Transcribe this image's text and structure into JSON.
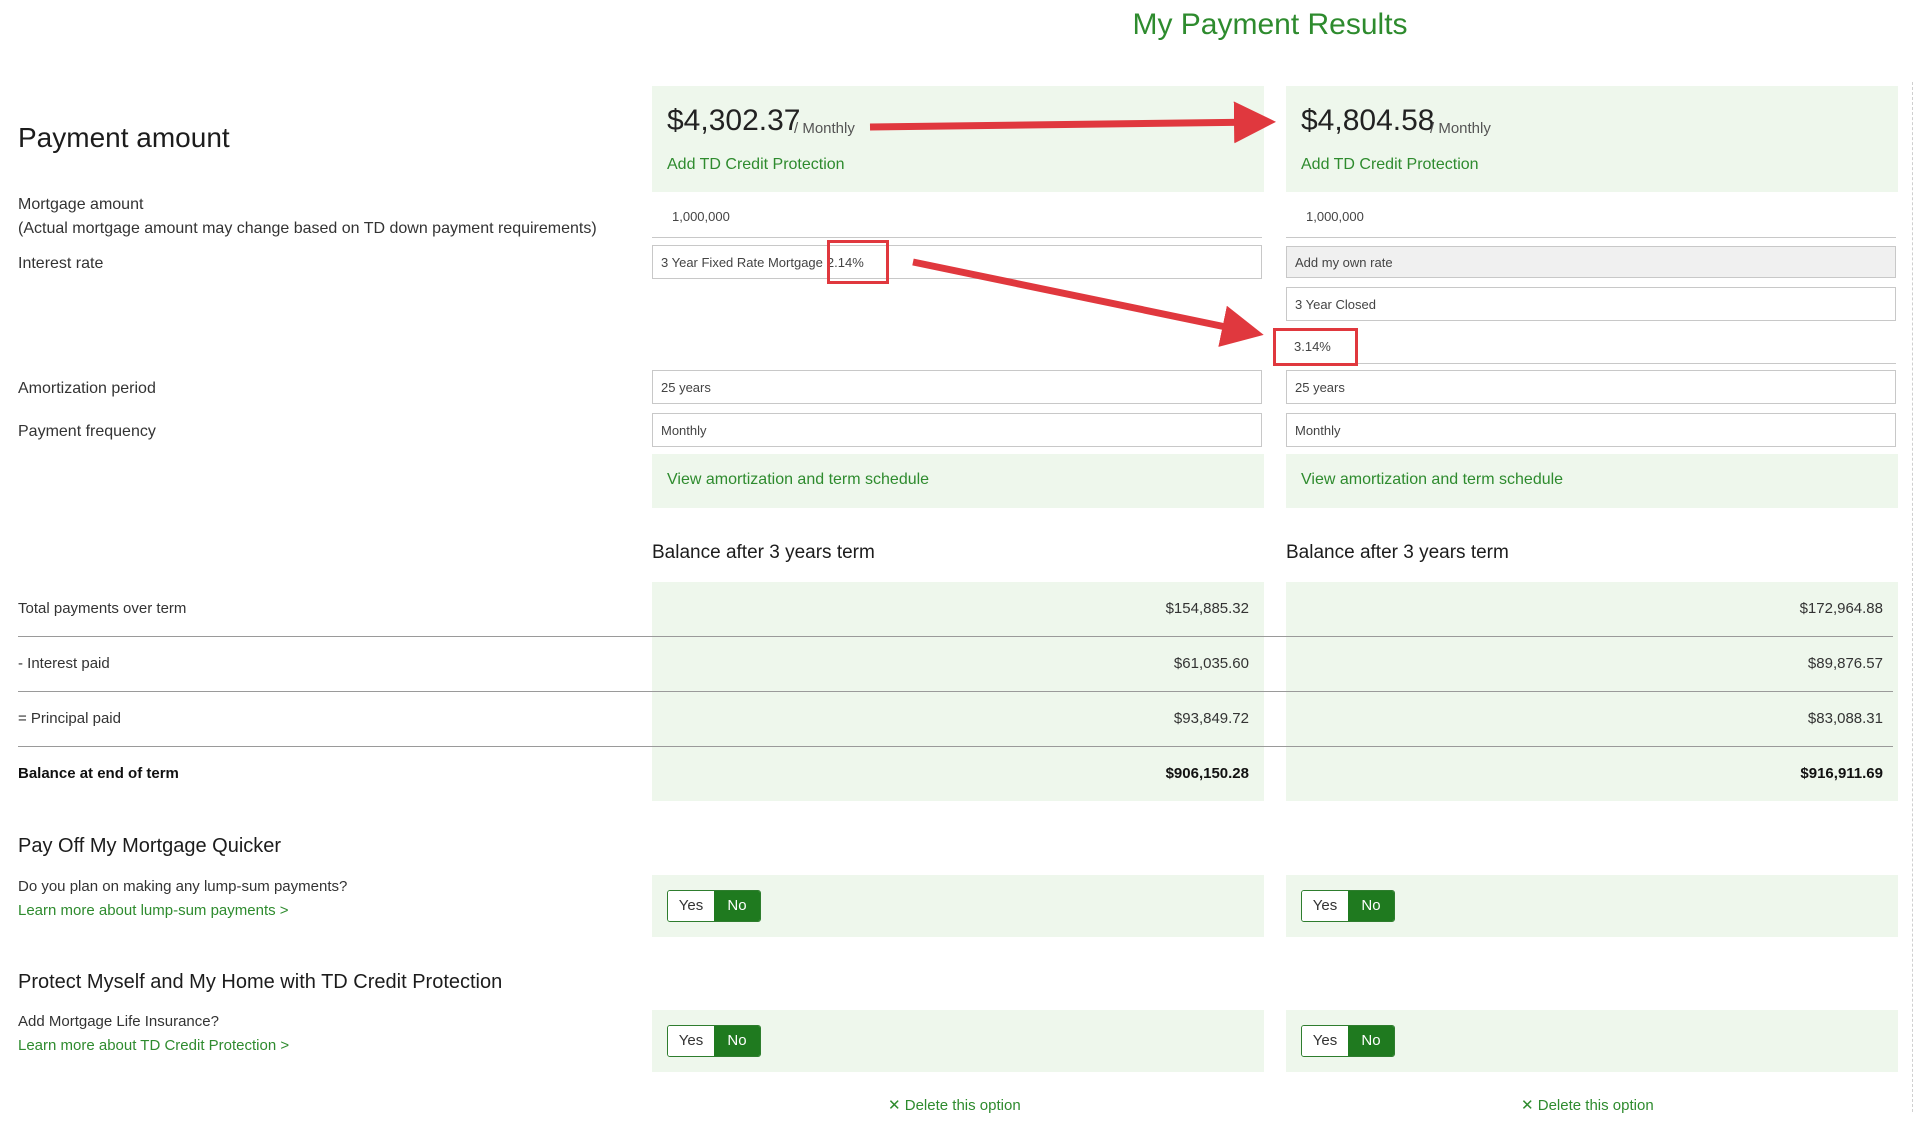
{
  "page_title": "My Payment Results",
  "payment_section_title": "Payment amount",
  "labels": {
    "mortgage_amount": "Mortgage amount",
    "mortgage_note": "(Actual mortgage amount may change based on TD down payment requirements)",
    "interest_rate": "Interest rate",
    "amortization": "Amortization period",
    "frequency": "Payment frequency",
    "total_payments": "Total payments over term",
    "interest_paid": "- Interest paid",
    "principal_paid": "= Principal paid",
    "balance_end": "Balance at end of term"
  },
  "options": [
    {
      "payment": "$4,302.37",
      "per": "/ Monthly",
      "add_protection": "Add TD Credit Protection",
      "mortgage_amount": "1,000,000",
      "rate_text": "3 Year Fixed Rate Mortgage",
      "rate_value": "2.14%",
      "amortization": "25 years",
      "frequency": "Monthly",
      "schedule_link": "View amortization and term schedule",
      "balance_heading": "Balance after 3 years term",
      "total_payments": "$154,885.32",
      "interest_paid": "$61,035.60",
      "principal_paid": "$93,849.72",
      "balance_end": "$906,150.28",
      "delete": "Delete this option"
    },
    {
      "payment": "$4,804.58",
      "per": "/ Monthly",
      "add_protection": "Add TD Credit Protection",
      "mortgage_amount": "1,000,000",
      "own_rate": "Add my own rate",
      "term": "3 Year Closed",
      "rate_value": "3.14%",
      "amortization": "25 years",
      "frequency": "Monthly",
      "schedule_link": "View amortization and term schedule",
      "balance_heading": "Balance after 3 years term",
      "total_payments": "$172,964.88",
      "interest_paid": "$89,876.57",
      "principal_paid": "$83,088.31",
      "balance_end": "$916,911.69",
      "delete": "Delete this option"
    }
  ],
  "payoff": {
    "title": "Pay Off My Mortgage Quicker",
    "question": "Do you plan on making any lump-sum payments?",
    "link": "Learn more about lump-sum payments >"
  },
  "protect": {
    "title": "Protect Myself and My Home with TD Credit Protection",
    "question": "Add Mortgage Life Insurance?",
    "link": "Learn more about TD Credit Protection >"
  },
  "toggle": {
    "yes": "Yes",
    "no": "No"
  },
  "delete_icon": "close-x-icon",
  "colors": {
    "accent_green": "#2e8b2e",
    "panel_green": "#eef7ec",
    "toggle_green": "#1f7a1f",
    "annotation_red": "#e0383e"
  }
}
